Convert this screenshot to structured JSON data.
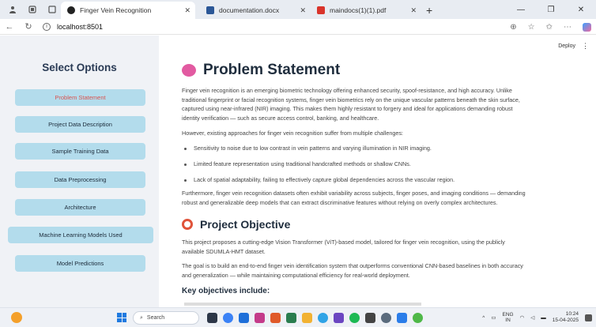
{
  "browser": {
    "tabs": [
      {
        "title": "Finger Vein Recognition",
        "active": true,
        "favicon_color": "#222222"
      },
      {
        "title": "documentation.docx",
        "active": false,
        "favicon_color": "#2b5797"
      },
      {
        "title": "maindocs(1)(1).pdf",
        "active": false,
        "favicon_color": "#d9342b"
      }
    ],
    "new_tab": "+",
    "url": "localhost:8501"
  },
  "sidebar": {
    "title": "Select Options",
    "items": [
      {
        "label": "Problem Statement",
        "active": true
      },
      {
        "label": "Project Data Description",
        "active": false
      },
      {
        "label": "Sample Training Data",
        "active": false
      },
      {
        "label": "Data Preprocessing",
        "active": false
      },
      {
        "label": "Architecture",
        "active": false
      },
      {
        "label": "Machine Learning Models Used",
        "active": false
      },
      {
        "label": "Model Predictions",
        "active": false
      }
    ]
  },
  "header": {
    "deploy": "Deploy",
    "menu": "⋮"
  },
  "main": {
    "title": "Problem Statement",
    "intro_lines": [
      "Finger vein recognition is an emerging biometric technology offering enhanced security, spoof-resistance, and high accuracy. Unlike",
      "traditional fingerprint or facial recognition systems, finger vein biometrics rely on the unique vascular patterns beneath the skin surface,",
      "captured using near-infrared (NIR) imaging. This makes them highly resistant to forgery and ideal for applications demanding robust",
      "identity verification — such as secure access control, banking, and healthcare."
    ],
    "challenges_intro": "However, existing approaches for finger vein recognition suffer from multiple challenges:",
    "bullets": [
      "Sensitivity to noise due to low contrast in vein patterns and varying illumination in NIR imaging.",
      "Limited feature representation using traditional handcrafted methods or shallow CNNs.",
      "Lack of spatial adaptability, failing to effectively capture global dependencies across the vascular region."
    ],
    "variability_lines": [
      "Furthermore, finger vein recognition datasets often exhibit variability across subjects, finger poses, and imaging conditions — demanding",
      "robust and generalizable deep models that can extract discriminative features without relying on overly complex architectures."
    ],
    "objective_title": "Project Objective",
    "objective_lines": [
      "This project proposes a cutting-edge Vision Transformer (ViT)-based model, tailored for finger vein recognition, using the publicly",
      "available SDUMLA-HMT dataset."
    ],
    "goal_lines": [
      "The goal is to build an end-to-end finger vein identification system that outperforms conventional CNN-based baselines in both accuracy",
      "and generalization — while maintaining computational efficiency for real-world deployment."
    ],
    "key_objectives_title": "Key objectives include:"
  },
  "taskbar": {
    "search_label": "Search",
    "lang_line1": "ENG",
    "lang_line2": "IN",
    "time": "10:24",
    "date": "15-04-2025"
  }
}
